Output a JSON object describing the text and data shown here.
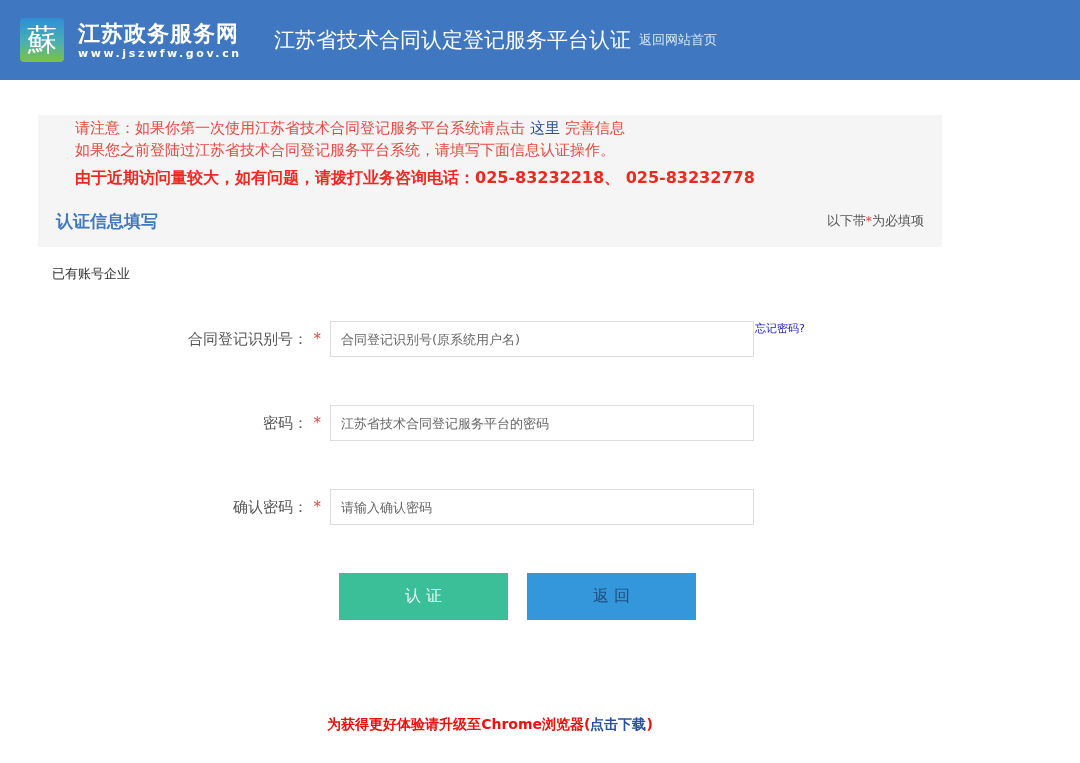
{
  "header": {
    "logo_mark": "蘇",
    "site_name": "江苏政务服务网",
    "site_url": "www.jszwfw.gov.cn",
    "title": "江苏省技术合同认定登记服务平台认证",
    "home_link": "返回网站首页"
  },
  "notice": {
    "line1_before": "请注意：如果你第一次使用江苏省技术合同登记服务平台系统请点击 ",
    "line1_link": "这里",
    "line1_after": " 完善信息",
    "line2": "如果您之前登陆过江苏省技术合同登记服务平台系统，请填写下面信息认证操作。",
    "line3": "由于近期访问量较大，如有问题，请拨打业务咨询电话：025-83232218、 025-83232778"
  },
  "section": {
    "title": "认证信息填写",
    "required_before": "以下带",
    "required_mark": "*",
    "required_after": "为必填项"
  },
  "subtitle": "已有账号企业",
  "fields": [
    {
      "label": "合同登记识别号：",
      "required": true,
      "placeholder": "合同登记识别号(原系统用户名)",
      "side_link": "忘记密码?"
    },
    {
      "label": "密码：",
      "required": true,
      "placeholder": "江苏省技术合同登记服务平台的密码"
    },
    {
      "label": "确认密码：",
      "required": true,
      "placeholder": "请输入确认密码"
    }
  ],
  "buttons": [
    {
      "label": "认 证",
      "kind": "primary"
    },
    {
      "label": "返 回",
      "kind": "secondary"
    }
  ],
  "footer": {
    "before": "为获得更好体验请升级至Chrome浏览器(",
    "link": "点击下载",
    "after": ")"
  }
}
